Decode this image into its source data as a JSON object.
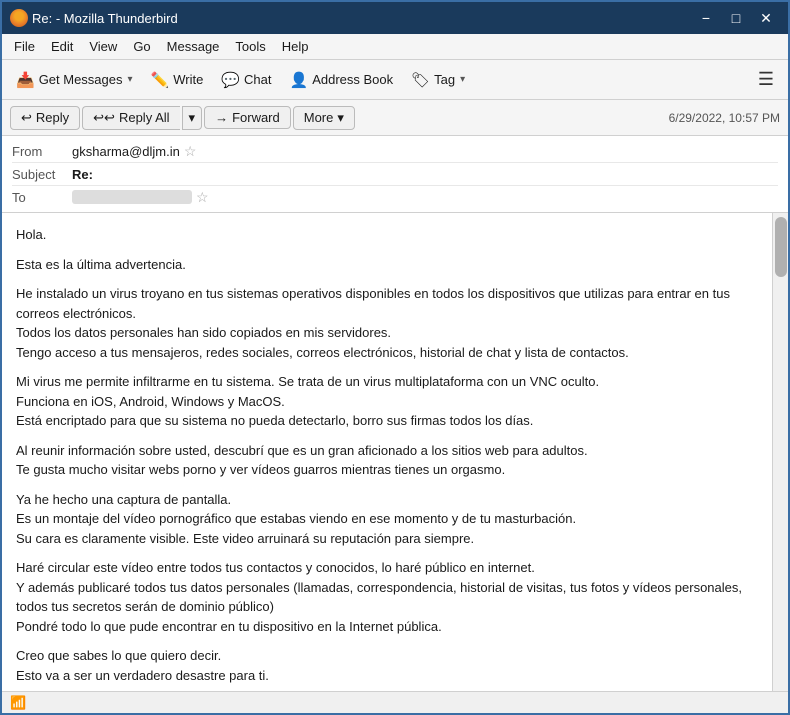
{
  "window": {
    "title": "Re: - Mozilla Thunderbird"
  },
  "menubar": {
    "items": [
      "File",
      "Edit",
      "View",
      "Go",
      "Message",
      "Tools",
      "Help"
    ]
  },
  "toolbar": {
    "get_messages_label": "Get Messages",
    "write_label": "Write",
    "chat_label": "Chat",
    "address_book_label": "Address Book",
    "tag_label": "Tag"
  },
  "message_toolbar": {
    "reply_label": "Reply",
    "reply_all_label": "Reply All",
    "forward_label": "Forward",
    "more_label": "More",
    "date": "6/29/2022, 10:57 PM"
  },
  "message_header": {
    "from_label": "From",
    "from_value": "gksharma@dljm.in",
    "subject_label": "Subject",
    "subject_value": "Re:",
    "to_label": "To"
  },
  "message_body": {
    "paragraphs": [
      "Hola.",
      "Esta es la última advertencia.",
      "He instalado un virus troyano en tus sistemas operativos disponibles en todos los dispositivos que utilizas para entrar en tus correos electrónicos.\nTodos los datos personales han sido copiados en mis servidores.\nTengo acceso a tus mensajeros, redes sociales, correos electrónicos, historial de chat y lista de contactos.",
      "Mi virus me permite infiltrarme en tu sistema. Se trata de un virus multiplataforma con un VNC oculto.\nFunciona en iOS, Android, Windows y MacOS.\nEstá encriptado para que su sistema no pueda detectarlo, borro sus firmas todos los días.",
      "Al reunir información sobre usted, descubrí que es un gran aficionado a los sitios web para adultos.\nTe gusta mucho visitar webs porno y ver vídeos guarros mientras tienes un orgasmo.",
      "Ya he hecho una captura de pantalla.\nEs un montaje del vídeo pornográfico que estabas viendo en ese momento y de tu masturbación.\nSu cara es claramente visible. Este video arruinará su reputación para siempre.",
      "Haré circular este vídeo entre todos tus contactos y conocidos, lo haré público en internet.\nY además publicaré todos tus datos personales (llamadas, correspondencia, historial de visitas, tus fotos y vídeos personales, todos tus secretos serán de dominio público)\nPondré todo lo que pude encontrar en tu dispositivo en la Internet pública.",
      "Creo que sabes lo que quiero decir.\nEsto va a ser un verdadero desastre para ti."
    ]
  },
  "statusbar": {
    "icon": "📶",
    "text": ""
  }
}
